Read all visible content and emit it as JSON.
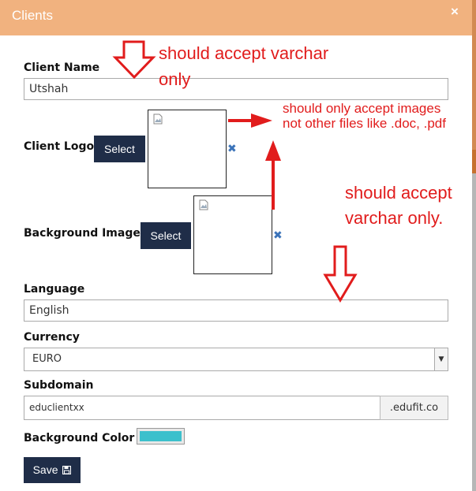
{
  "dialog": {
    "title": "Clients",
    "close_icon": "close-icon",
    "close_glyph": "×"
  },
  "form": {
    "client_name": {
      "label": "Client Name",
      "value": "Utshah"
    },
    "client_logo": {
      "label": "Client Logo",
      "button": "Select",
      "remove_glyph": "✖"
    },
    "background_image": {
      "label": "Background Image",
      "button": "Select",
      "remove_glyph": "✖"
    },
    "language": {
      "label": "Language",
      "value": "English"
    },
    "currency": {
      "label": "Currency",
      "value": "EURO"
    },
    "subdomain": {
      "label": "Subdomain",
      "value": "educlientxx",
      "suffix": ".edufit.co"
    },
    "background_color": {
      "label": "Background Color",
      "value": "#3cc0cc"
    },
    "save": {
      "label": "Save",
      "icon": "floppy-disk-icon"
    }
  },
  "annotations": {
    "varchar_line1": "should accept varchar",
    "varchar_line2": "only",
    "images_line1": "should only accept images",
    "images_line2": "not other files like .doc, .pdf",
    "varchar2_line1": "should accept",
    "varchar2_line2": "varchar only."
  },
  "colors": {
    "header": "#f1b27f",
    "button": "#1f2d48",
    "annotation": "#e11c1c"
  }
}
